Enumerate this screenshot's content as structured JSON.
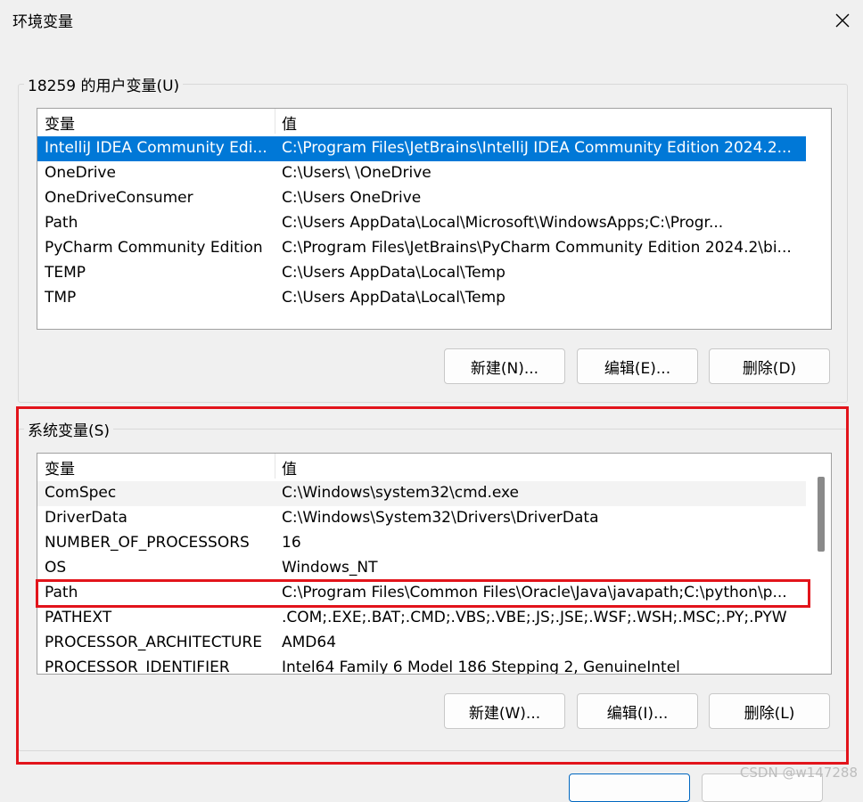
{
  "window": {
    "title": "环境变量",
    "close_icon": "close-icon"
  },
  "user_vars": {
    "group_label": "18259 的用户变量(U)",
    "columns": [
      "变量",
      "值"
    ],
    "rows": [
      {
        "name": "IntelliJ IDEA Community Edi...",
        "value": "C:\\Program Files\\JetBrains\\IntelliJ IDEA Community Edition 2024.2..."
      },
      {
        "name": "OneDrive",
        "value": "C:\\Users\\          \\OneDrive"
      },
      {
        "name": "OneDriveConsumer",
        "value": "C:\\Users          OneDrive"
      },
      {
        "name": "Path",
        "value": "C:\\Users          AppData\\Local\\Microsoft\\WindowsApps;C:\\Progr..."
      },
      {
        "name": "PyCharm Community Edition",
        "value": "C:\\Program Files\\JetBrains\\PyCharm Community Edition 2024.2\\bi..."
      },
      {
        "name": "TEMP",
        "value": "C:\\Users          AppData\\Local\\Temp"
      },
      {
        "name": "TMP",
        "value": "C:\\Users          AppData\\Local\\Temp"
      }
    ],
    "buttons": {
      "new": "新建(N)...",
      "edit": "编辑(E)...",
      "delete": "删除(D)"
    }
  },
  "system_vars": {
    "group_label": "系统变量(S)",
    "columns": [
      "变量",
      "值"
    ],
    "rows": [
      {
        "name": "ComSpec",
        "value": "C:\\Windows\\system32\\cmd.exe"
      },
      {
        "name": "DriverData",
        "value": "C:\\Windows\\System32\\Drivers\\DriverData"
      },
      {
        "name": "NUMBER_OF_PROCESSORS",
        "value": "16"
      },
      {
        "name": "OS",
        "value": "Windows_NT"
      },
      {
        "name": "Path",
        "value": "C:\\Program Files\\Common Files\\Oracle\\Java\\javapath;C:\\python\\p..."
      },
      {
        "name": "PATHEXT",
        "value": ".COM;.EXE;.BAT;.CMD;.VBS;.VBE;.JS;.JSE;.WSF;.WSH;.MSC;.PY;.PYW"
      },
      {
        "name": "PROCESSOR_ARCHITECTURE",
        "value": "AMD64"
      },
      {
        "name": "PROCESSOR_IDENTIFIER",
        "value": "Intel64 Family 6 Model 186 Stepping 2, GenuineIntel"
      }
    ],
    "buttons": {
      "new": "新建(W)...",
      "edit": "编辑(I)...",
      "delete": "删除(L)"
    }
  },
  "watermark": "CSDN @w147288",
  "colors": {
    "selection": "#0078d7",
    "highlight_box": "#e2141b"
  }
}
